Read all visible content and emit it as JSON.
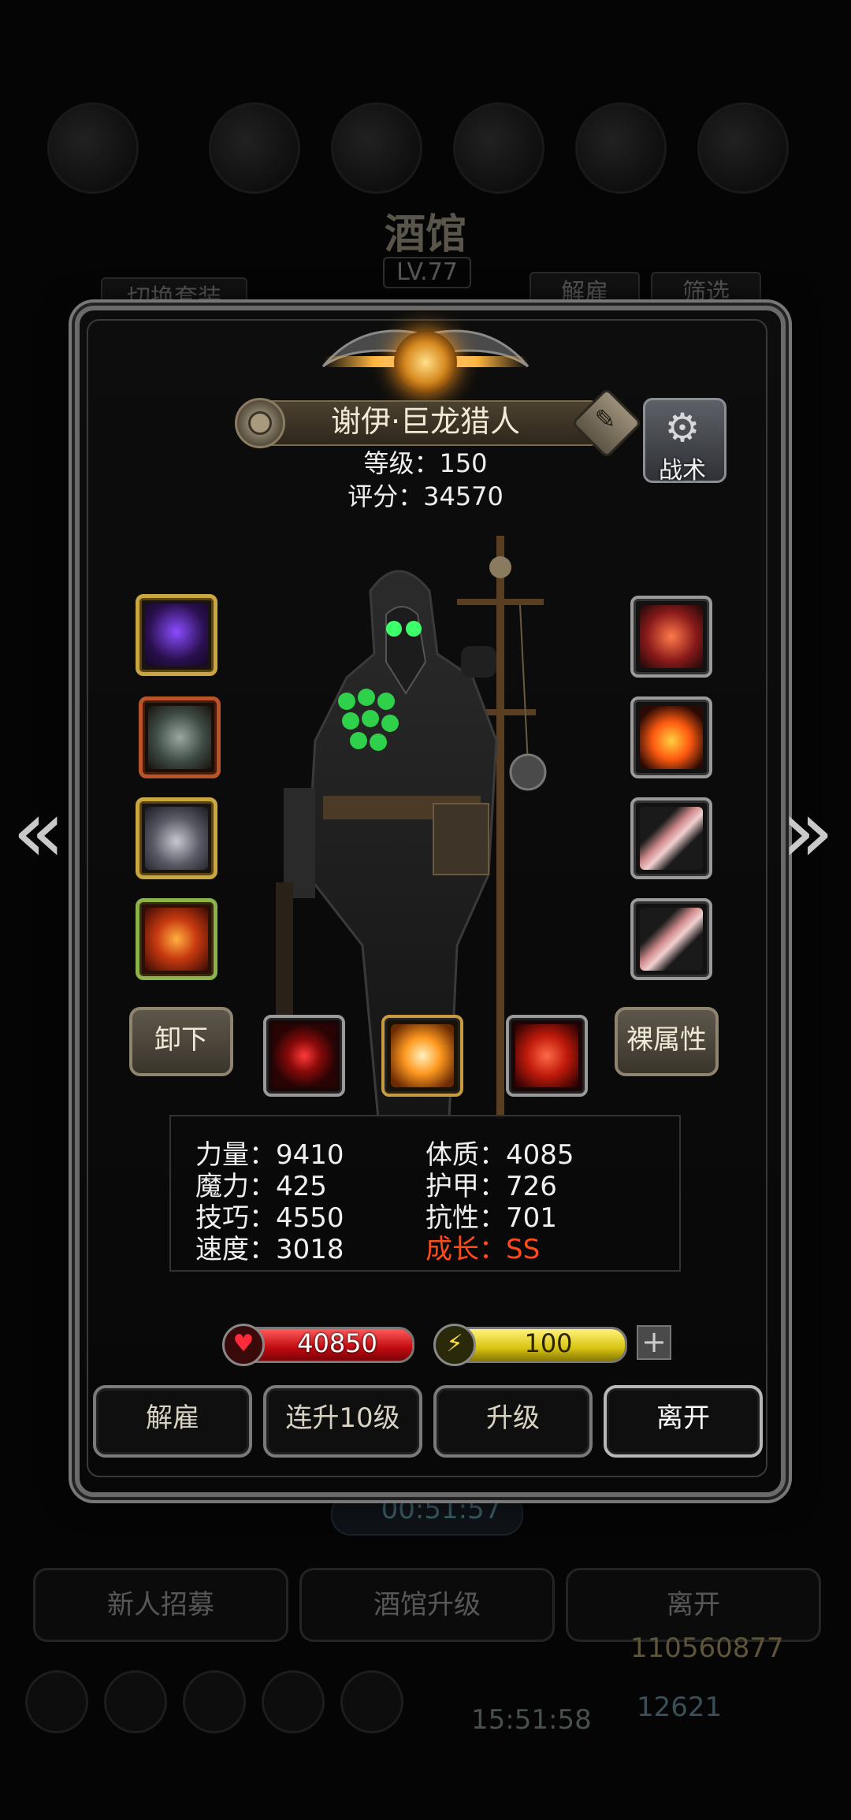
{
  "background": {
    "title": "酒馆",
    "level": "LV.77",
    "switch_set_label": "切换套装",
    "dismiss_label": "解雇",
    "filter_label": "筛选",
    "timer": "00:51:57",
    "recruit_label": "新人招募",
    "upgrade_tavern_label": "酒馆升级",
    "leave_label": "离开",
    "gold": "110560877",
    "clock": "15:51:58",
    "gems": "12621"
  },
  "hero": {
    "name": "谢伊·巨龙猎人",
    "level_line": "等级：150",
    "score_line": "评分：34570",
    "tactics_label": "战术"
  },
  "actions": {
    "unequip_label": "卸下",
    "bare_attr_label": "裸属性"
  },
  "stats": {
    "strength": "力量：9410",
    "constitution": "体质：4085",
    "magic": "魔力：425",
    "armor": "护甲：726",
    "skill": "技巧：4550",
    "resistance": "抗性：701",
    "speed": "速度：3018",
    "growth": "成长：SS"
  },
  "bars": {
    "hp_value": "40850",
    "energy_value": "100",
    "hp_fill": 1.0,
    "energy_fill": 1.0,
    "hp_color": "#d8141c",
    "energy_color": "#e6d21a"
  },
  "buttons": {
    "dismiss": "解雇",
    "level10": "连升10级",
    "upgrade": "升级",
    "leave": "离开"
  },
  "icons": {
    "left": [
      "pistol-icon",
      "shoulder-armor-icon",
      "helmet-icon",
      "flame-staff-icon"
    ],
    "right": [
      "dragon-heart-icon",
      "fire-orb-icon",
      "feather-icon",
      "feather-icon"
    ],
    "skills": [
      "crosshair-skill-icon",
      "dragon-skill-icon",
      "heal-cross-skill-icon"
    ]
  }
}
